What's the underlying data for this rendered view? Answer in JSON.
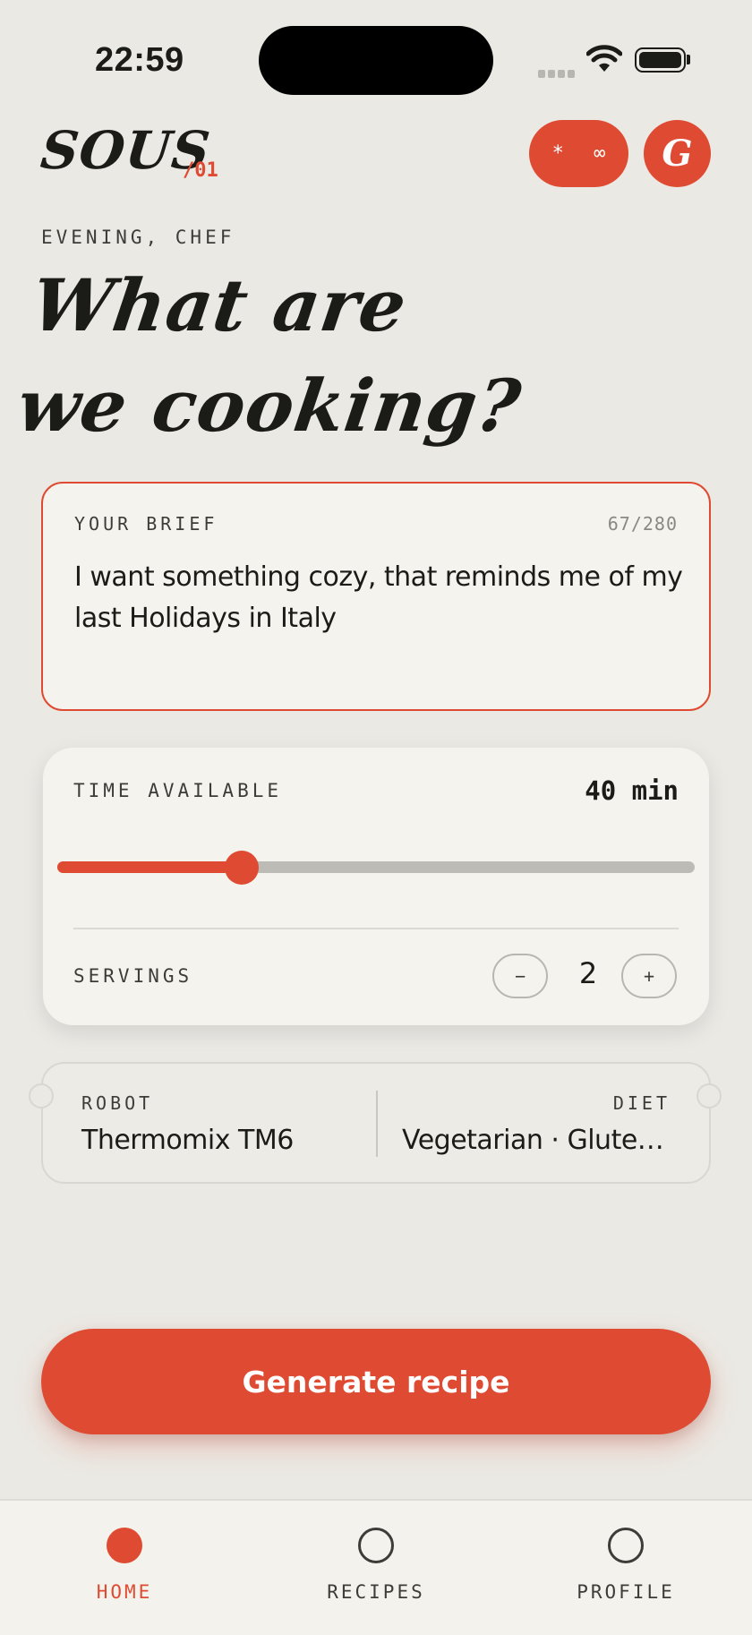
{
  "status_bar": {
    "time": "22:59"
  },
  "header": {
    "logo": "SOUS",
    "logo_number": "/01",
    "pill_label": "* ∞",
    "avatar_initial": "G"
  },
  "greeting": "EVENING, CHEF",
  "headline": {
    "line1": "What are",
    "line2": "we cooking?"
  },
  "brief": {
    "label": "YOUR BRIEF",
    "count": "67/280",
    "text": "I want something cozy, that reminds me of my last Holidays in Italy"
  },
  "settings": {
    "time_label": "TIME AVAILABLE",
    "time_value": "40 min",
    "time_fraction": 0.29,
    "servings_label": "SERVINGS",
    "servings_value": "2",
    "minus_label": "−",
    "plus_label": "+"
  },
  "ticket": {
    "robot_label": "ROBOT",
    "robot_value": "Thermomix TM6",
    "diet_label": "DIET",
    "diet_value": "Vegetarian · Gluten-free"
  },
  "cta": {
    "label": "Generate recipe"
  },
  "tabs": [
    {
      "label": "HOME",
      "active": true
    },
    {
      "label": "RECIPES",
      "active": false
    },
    {
      "label": "PROFILE",
      "active": false
    }
  ],
  "colors": {
    "accent": "#df4a32",
    "background": "#ebe9e4",
    "card": "#f5f3ed",
    "text": "#1b1b18"
  }
}
